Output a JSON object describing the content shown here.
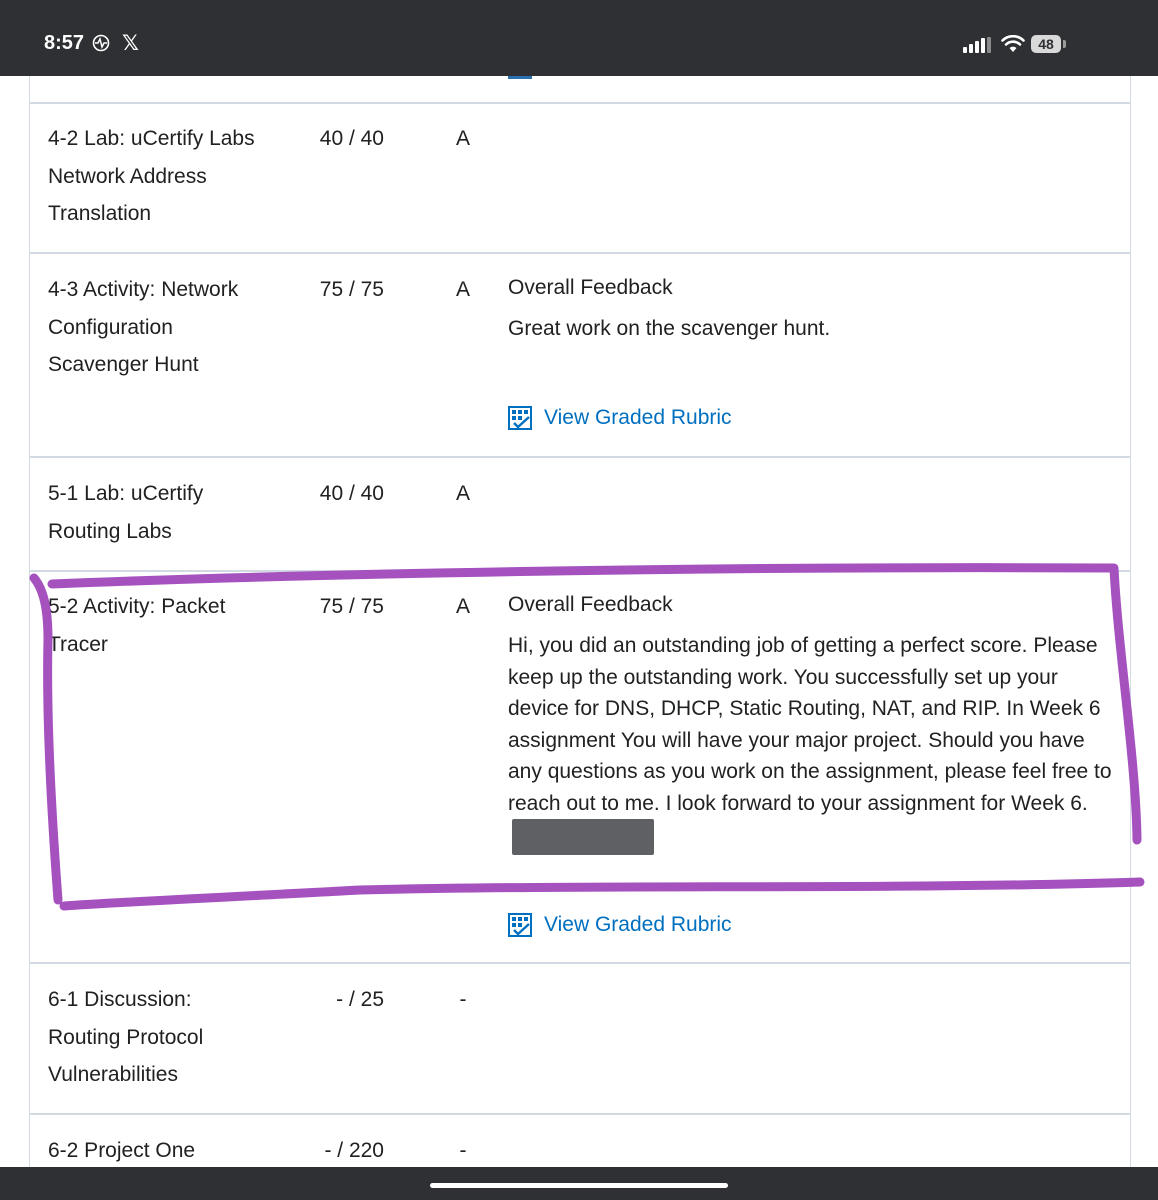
{
  "status_bar": {
    "time": "8:57",
    "x_logo": "𝕏",
    "battery": "48",
    "icons": [
      "activity-icon",
      "x-logo",
      "signal-icon",
      "wifi-icon",
      "battery-icon"
    ]
  },
  "rows": [
    {
      "name_lines": [
        "4-2 Lab: uCertify Labs",
        "Network Address",
        "Translation"
      ],
      "score": "40 / 40",
      "grade": "A"
    },
    {
      "name_lines": [
        "4-3 Activity: Network",
        "Configuration",
        "Scavenger Hunt"
      ],
      "score": "75 / 75",
      "grade": "A",
      "feedback_title": "Overall Feedback",
      "feedback_text": "Great work on the scavenger hunt.",
      "rubric_label": "View Graded Rubric"
    },
    {
      "name_lines": [
        "5-1 Lab: uCertify",
        "Routing Labs"
      ],
      "score": "40 / 40",
      "grade": "A"
    },
    {
      "name_lines": [
        "5-2 Activity: Packet",
        "Tracer"
      ],
      "score": "75 / 75",
      "grade": "A",
      "feedback_title": "Overall Feedback",
      "feedback_text": "Hi, you did an outstanding job of getting a perfect score. Please keep up the outstanding work.  You successfully set up your device for DNS, DHCP, Static Routing, NAT, and RIP. In Week 6 assignment You will have your major project. Should you have any questions as you work on the assignment, please feel free to reach out to me. I look forward to your assignment for Week 6.",
      "rubric_label": "View Graded Rubric"
    },
    {
      "name_lines": [
        "6-1 Discussion:",
        "Routing Protocol",
        "Vulnerabilities"
      ],
      "score": "- / 25",
      "grade": "-"
    },
    {
      "name_lines": [
        "6-2 Project One"
      ],
      "score": "- / 220",
      "grade": "-"
    }
  ],
  "colors": {
    "annotation": "#a552bf",
    "link": "#006fbf",
    "border": "#d3d9e3",
    "status_bar": "#2f3033",
    "redaction": "#5f6063"
  }
}
